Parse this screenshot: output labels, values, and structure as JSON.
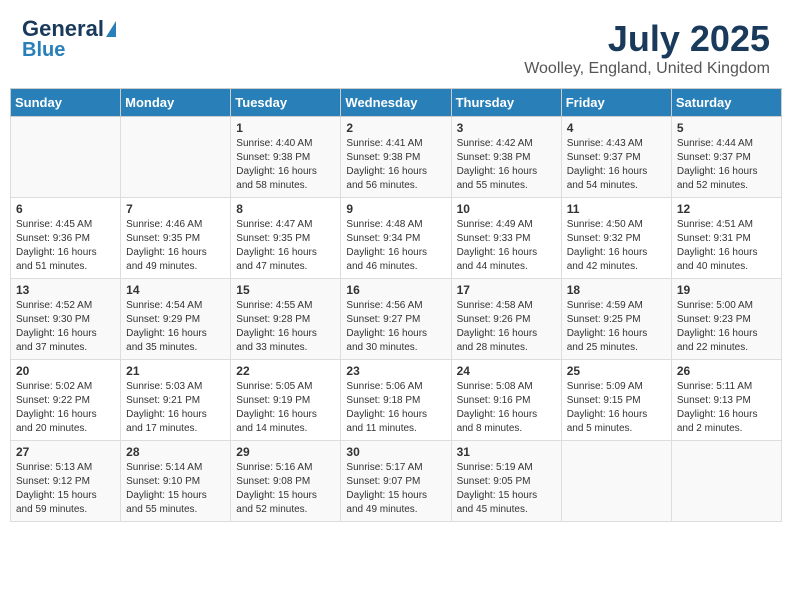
{
  "header": {
    "logo_line1": "General",
    "logo_line2": "Blue",
    "title": "July 2025",
    "subtitle": "Woolley, England, United Kingdom"
  },
  "calendar": {
    "days_of_week": [
      "Sunday",
      "Monday",
      "Tuesday",
      "Wednesday",
      "Thursday",
      "Friday",
      "Saturday"
    ],
    "weeks": [
      [
        {
          "day": "",
          "info": ""
        },
        {
          "day": "",
          "info": ""
        },
        {
          "day": "1",
          "info": "Sunrise: 4:40 AM\nSunset: 9:38 PM\nDaylight: 16 hours and 58 minutes."
        },
        {
          "day": "2",
          "info": "Sunrise: 4:41 AM\nSunset: 9:38 PM\nDaylight: 16 hours and 56 minutes."
        },
        {
          "day": "3",
          "info": "Sunrise: 4:42 AM\nSunset: 9:38 PM\nDaylight: 16 hours and 55 minutes."
        },
        {
          "day": "4",
          "info": "Sunrise: 4:43 AM\nSunset: 9:37 PM\nDaylight: 16 hours and 54 minutes."
        },
        {
          "day": "5",
          "info": "Sunrise: 4:44 AM\nSunset: 9:37 PM\nDaylight: 16 hours and 52 minutes."
        }
      ],
      [
        {
          "day": "6",
          "info": "Sunrise: 4:45 AM\nSunset: 9:36 PM\nDaylight: 16 hours and 51 minutes."
        },
        {
          "day": "7",
          "info": "Sunrise: 4:46 AM\nSunset: 9:35 PM\nDaylight: 16 hours and 49 minutes."
        },
        {
          "day": "8",
          "info": "Sunrise: 4:47 AM\nSunset: 9:35 PM\nDaylight: 16 hours and 47 minutes."
        },
        {
          "day": "9",
          "info": "Sunrise: 4:48 AM\nSunset: 9:34 PM\nDaylight: 16 hours and 46 minutes."
        },
        {
          "day": "10",
          "info": "Sunrise: 4:49 AM\nSunset: 9:33 PM\nDaylight: 16 hours and 44 minutes."
        },
        {
          "day": "11",
          "info": "Sunrise: 4:50 AM\nSunset: 9:32 PM\nDaylight: 16 hours and 42 minutes."
        },
        {
          "day": "12",
          "info": "Sunrise: 4:51 AM\nSunset: 9:31 PM\nDaylight: 16 hours and 40 minutes."
        }
      ],
      [
        {
          "day": "13",
          "info": "Sunrise: 4:52 AM\nSunset: 9:30 PM\nDaylight: 16 hours and 37 minutes."
        },
        {
          "day": "14",
          "info": "Sunrise: 4:54 AM\nSunset: 9:29 PM\nDaylight: 16 hours and 35 minutes."
        },
        {
          "day": "15",
          "info": "Sunrise: 4:55 AM\nSunset: 9:28 PM\nDaylight: 16 hours and 33 minutes."
        },
        {
          "day": "16",
          "info": "Sunrise: 4:56 AM\nSunset: 9:27 PM\nDaylight: 16 hours and 30 minutes."
        },
        {
          "day": "17",
          "info": "Sunrise: 4:58 AM\nSunset: 9:26 PM\nDaylight: 16 hours and 28 minutes."
        },
        {
          "day": "18",
          "info": "Sunrise: 4:59 AM\nSunset: 9:25 PM\nDaylight: 16 hours and 25 minutes."
        },
        {
          "day": "19",
          "info": "Sunrise: 5:00 AM\nSunset: 9:23 PM\nDaylight: 16 hours and 22 minutes."
        }
      ],
      [
        {
          "day": "20",
          "info": "Sunrise: 5:02 AM\nSunset: 9:22 PM\nDaylight: 16 hours and 20 minutes."
        },
        {
          "day": "21",
          "info": "Sunrise: 5:03 AM\nSunset: 9:21 PM\nDaylight: 16 hours and 17 minutes."
        },
        {
          "day": "22",
          "info": "Sunrise: 5:05 AM\nSunset: 9:19 PM\nDaylight: 16 hours and 14 minutes."
        },
        {
          "day": "23",
          "info": "Sunrise: 5:06 AM\nSunset: 9:18 PM\nDaylight: 16 hours and 11 minutes."
        },
        {
          "day": "24",
          "info": "Sunrise: 5:08 AM\nSunset: 9:16 PM\nDaylight: 16 hours and 8 minutes."
        },
        {
          "day": "25",
          "info": "Sunrise: 5:09 AM\nSunset: 9:15 PM\nDaylight: 16 hours and 5 minutes."
        },
        {
          "day": "26",
          "info": "Sunrise: 5:11 AM\nSunset: 9:13 PM\nDaylight: 16 hours and 2 minutes."
        }
      ],
      [
        {
          "day": "27",
          "info": "Sunrise: 5:13 AM\nSunset: 9:12 PM\nDaylight: 15 hours and 59 minutes."
        },
        {
          "day": "28",
          "info": "Sunrise: 5:14 AM\nSunset: 9:10 PM\nDaylight: 15 hours and 55 minutes."
        },
        {
          "day": "29",
          "info": "Sunrise: 5:16 AM\nSunset: 9:08 PM\nDaylight: 15 hours and 52 minutes."
        },
        {
          "day": "30",
          "info": "Sunrise: 5:17 AM\nSunset: 9:07 PM\nDaylight: 15 hours and 49 minutes."
        },
        {
          "day": "31",
          "info": "Sunrise: 5:19 AM\nSunset: 9:05 PM\nDaylight: 15 hours and 45 minutes."
        },
        {
          "day": "",
          "info": ""
        },
        {
          "day": "",
          "info": ""
        }
      ]
    ]
  }
}
